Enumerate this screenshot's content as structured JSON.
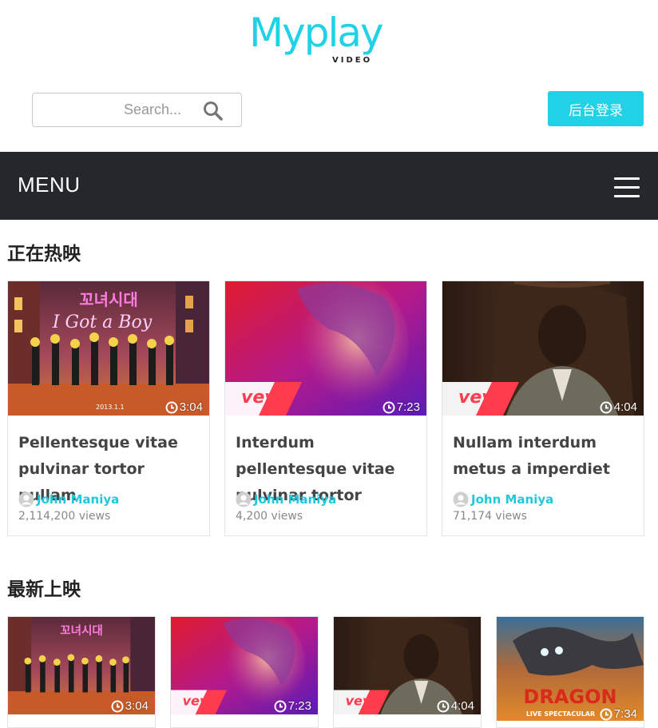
{
  "logo": {
    "text": "Myplay",
    "sub": "VIDEO"
  },
  "search": {
    "placeholder": "Search..."
  },
  "header": {
    "login_label": "后台登录"
  },
  "menu": {
    "label": "MENU"
  },
  "sections": {
    "now_playing": {
      "title": "正在热映",
      "videos": [
        {
          "title": "Pellentesque vitae pulvinar tortor nullam",
          "author": "John Maniya",
          "views": "2,114,200 views",
          "duration": "3:04"
        },
        {
          "title": "Interdum pellentesque vitae pulvinar tortor",
          "author": "John Maniya",
          "views": "4,200 views",
          "duration": "7:23"
        },
        {
          "title": "Nullam interdum metus a imperdiet",
          "author": "John Maniya",
          "views": "71,174 views",
          "duration": "4:04"
        }
      ]
    },
    "latest": {
      "title": "最新上映",
      "videos": [
        {
          "duration": "3:04"
        },
        {
          "duration": "7:23"
        },
        {
          "duration": "4:04"
        },
        {
          "duration": "7:34"
        }
      ]
    }
  },
  "thumb_text": {
    "vevo": "vevo",
    "dragon": "DRAGON",
    "dragon_sub": "LIVE SPECTACULAR",
    "kpop_date": "2013.1.1"
  },
  "colors": {
    "accent": "#21d2e6",
    "menubar": "#24282d"
  }
}
